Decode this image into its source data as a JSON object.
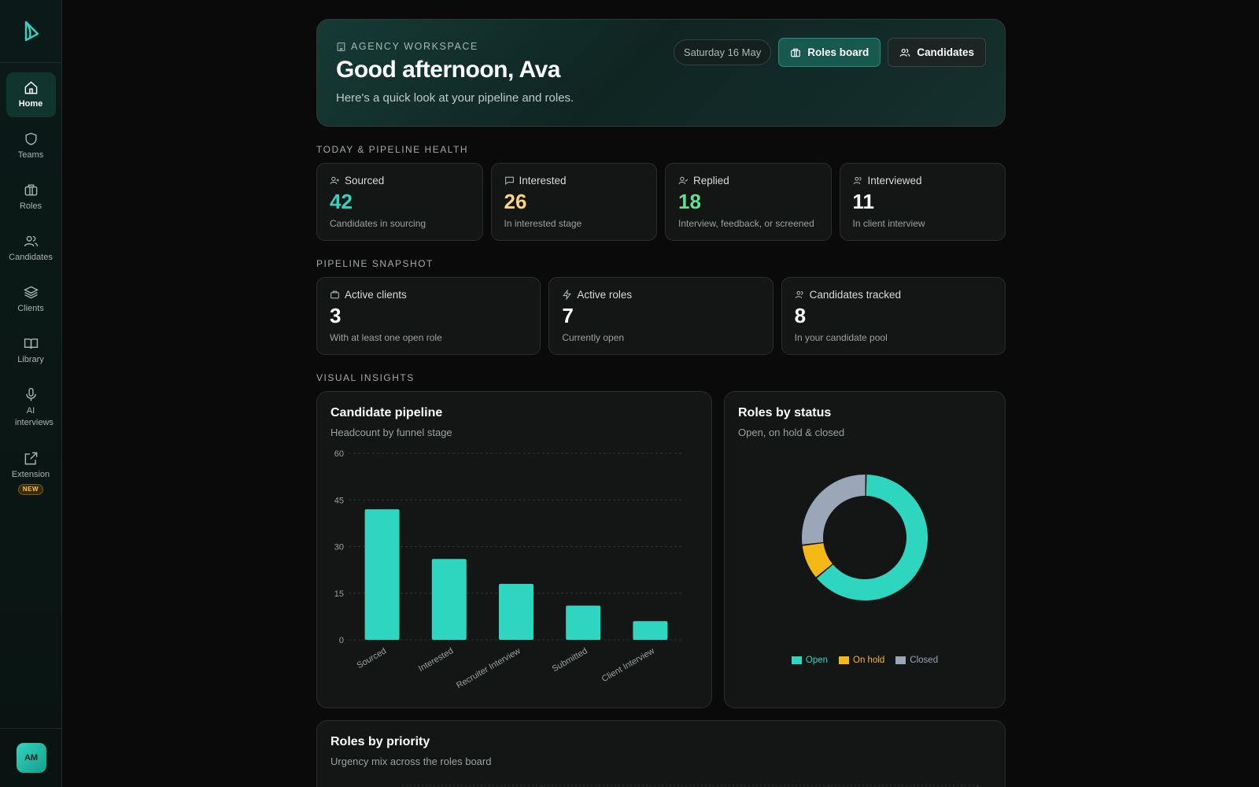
{
  "sidebar": {
    "items": [
      {
        "label": "Home",
        "icon": "home-icon",
        "active": true
      },
      {
        "label": "Teams",
        "icon": "shield-icon"
      },
      {
        "label": "Roles",
        "icon": "briefcase-icon"
      },
      {
        "label": "Candidates",
        "icon": "users-icon"
      },
      {
        "label": "Clients",
        "icon": "layers-icon"
      },
      {
        "label": "Library",
        "icon": "book-icon"
      },
      {
        "label": "AI interviews",
        "icon": "mic-icon"
      },
      {
        "label": "Extension",
        "icon": "external-link-icon",
        "badge": "NEW"
      }
    ],
    "avatar_initials": "AM"
  },
  "hero": {
    "eyebrow": "AGENCY WORKSPACE",
    "title": "Good afternoon, Ava",
    "subtitle": "Here's a quick look at your pipeline and roles.",
    "date": "Saturday 16 May",
    "roles_board_label": "Roles board",
    "candidates_label": "Candidates"
  },
  "sections": {
    "today": "TODAY & PIPELINE HEALTH",
    "snapshot": "PIPELINE SNAPSHOT",
    "insights": "VISUAL INSIGHTS"
  },
  "health": [
    {
      "label": "Sourced",
      "value": "42",
      "sub": "Candidates in sourcing",
      "color": "#2fd6bf"
    },
    {
      "label": "Interested",
      "value": "26",
      "sub": "In interested stage",
      "color": "#f8d57a"
    },
    {
      "label": "Replied",
      "value": "18",
      "sub": "Interview, feedback, or screened",
      "color": "#5fe08f"
    },
    {
      "label": "Interviewed",
      "value": "11",
      "sub": "In client interview",
      "color": "#ffffff"
    }
  ],
  "snapshot": [
    {
      "label": "Active clients",
      "value": "3",
      "sub": "With at least one open role"
    },
    {
      "label": "Active roles",
      "value": "7",
      "sub": "Currently open"
    },
    {
      "label": "Candidates tracked",
      "value": "8",
      "sub": "In your candidate pool"
    }
  ],
  "pipeline_card": {
    "title": "Candidate pipeline",
    "subtitle": "Headcount by funnel stage"
  },
  "status_card": {
    "title": "Roles by status",
    "subtitle": "Open, on hold & closed"
  },
  "priority_card": {
    "title": "Roles by priority",
    "subtitle": "Urgency mix across the roles board"
  },
  "chart_data": [
    {
      "type": "bar",
      "categories": [
        "Sourced",
        "Interested",
        "Recruiter Interview",
        "Submitted",
        "Client Interview"
      ],
      "values": [
        42,
        26,
        18,
        11,
        6
      ],
      "ylim": [
        0,
        60
      ],
      "yticks": [
        0,
        15,
        30,
        45,
        60
      ],
      "grid": true,
      "color": "#2fd6bf"
    },
    {
      "type": "pie",
      "donut": true,
      "categories": [
        "Open",
        "On hold",
        "Closed"
      ],
      "values": [
        7,
        1,
        3
      ],
      "colors": [
        "#2fd6bf",
        "#f5b916",
        "#9ba6b9"
      ],
      "legend": "bottom"
    }
  ]
}
